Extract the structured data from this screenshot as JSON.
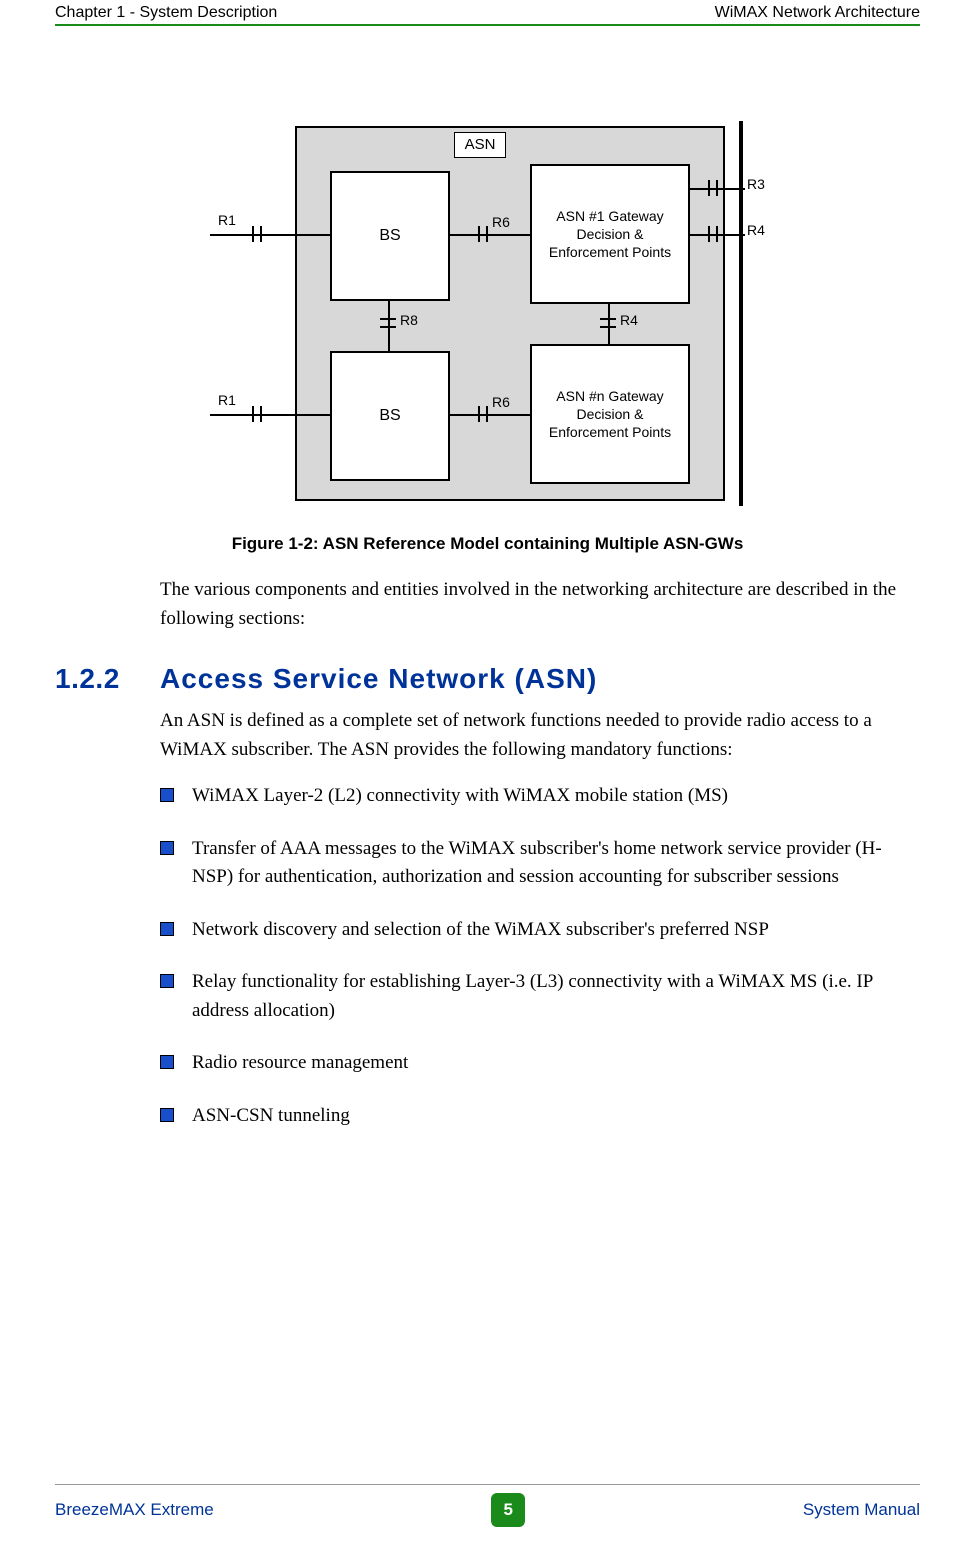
{
  "header": {
    "left": "Chapter 1 - System Description",
    "right": "WiMAX Network Architecture"
  },
  "figure": {
    "asn": "ASN",
    "bs": "BS",
    "gw1": "ASN #1 Gateway Decision & Enforcement Points",
    "gw2": "ASN #n Gateway Decision & Enforcement Points",
    "r1": "R1",
    "r3": "R3",
    "r4": "R4",
    "r6": "R6",
    "r8": "R8",
    "caption": "Figure 1-2: ASN Reference Model containing Multiple ASN-GWs"
  },
  "para1": "The various components and entities involved in the networking architecture are described in the following sections:",
  "section": {
    "num": "1.2.2",
    "title": "Access Service Network (ASN)"
  },
  "para2": "An ASN is defined as a complete set of network functions needed to provide radio access to a WiMAX subscriber. The ASN provides the following mandatory functions:",
  "bullets": [
    "WiMAX Layer-2 (L2) connectivity with WiMAX mobile station (MS)",
    "Transfer of AAA messages to the WiMAX subscriber's home network service provider (H-NSP) for authentication, authorization and session accounting for subscriber sessions",
    "Network discovery and selection of the WiMAX subscriber's preferred NSP",
    "Relay functionality for establishing Layer-3 (L3) connectivity with a WiMAX MS (i.e. IP address allocation)",
    "Radio resource management",
    "ASN-CSN tunneling"
  ],
  "footer": {
    "left": "BreezeMAX Extreme",
    "page": "5",
    "right": "System Manual"
  }
}
